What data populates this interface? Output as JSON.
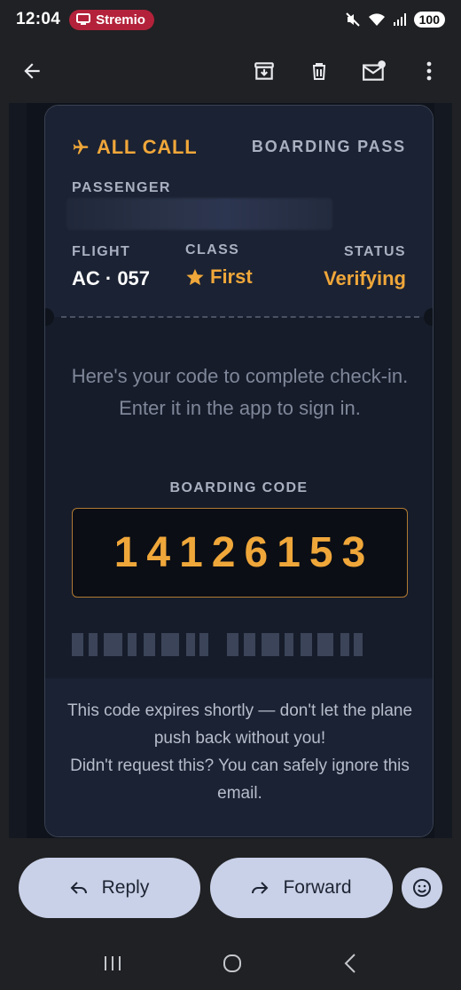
{
  "status_bar": {
    "time": "12:04",
    "app_name": "Stremio",
    "battery": "100"
  },
  "app_bar": {
    "icons": [
      "back-arrow-icon",
      "archive-icon",
      "delete-icon",
      "mark-unread-icon",
      "more-vert-icon"
    ]
  },
  "ticket": {
    "brand": "ALL CALL",
    "title": "BOARDING PASS",
    "passenger_label": "PASSENGER",
    "flight_label": "FLIGHT",
    "flight_value": "AC · 057",
    "class_label": "CLASS",
    "class_value": "First",
    "status_label": "STATUS",
    "status_value": "Verifying",
    "intro": "Here's your code to complete check-in. Enter it in the app to sign in.",
    "code_label": "BOARDING CODE",
    "code": "14126153",
    "footer_line1": "This code expires shortly — don't let the plane push back without you!",
    "footer_line2": "Didn't request this? You can safely ignore this email.",
    "colors": {
      "accent": "#f0a73a",
      "card": "#161c2a",
      "panel": "#1b2233"
    }
  },
  "actions": {
    "reply_label": "Reply",
    "forward_label": "Forward"
  }
}
